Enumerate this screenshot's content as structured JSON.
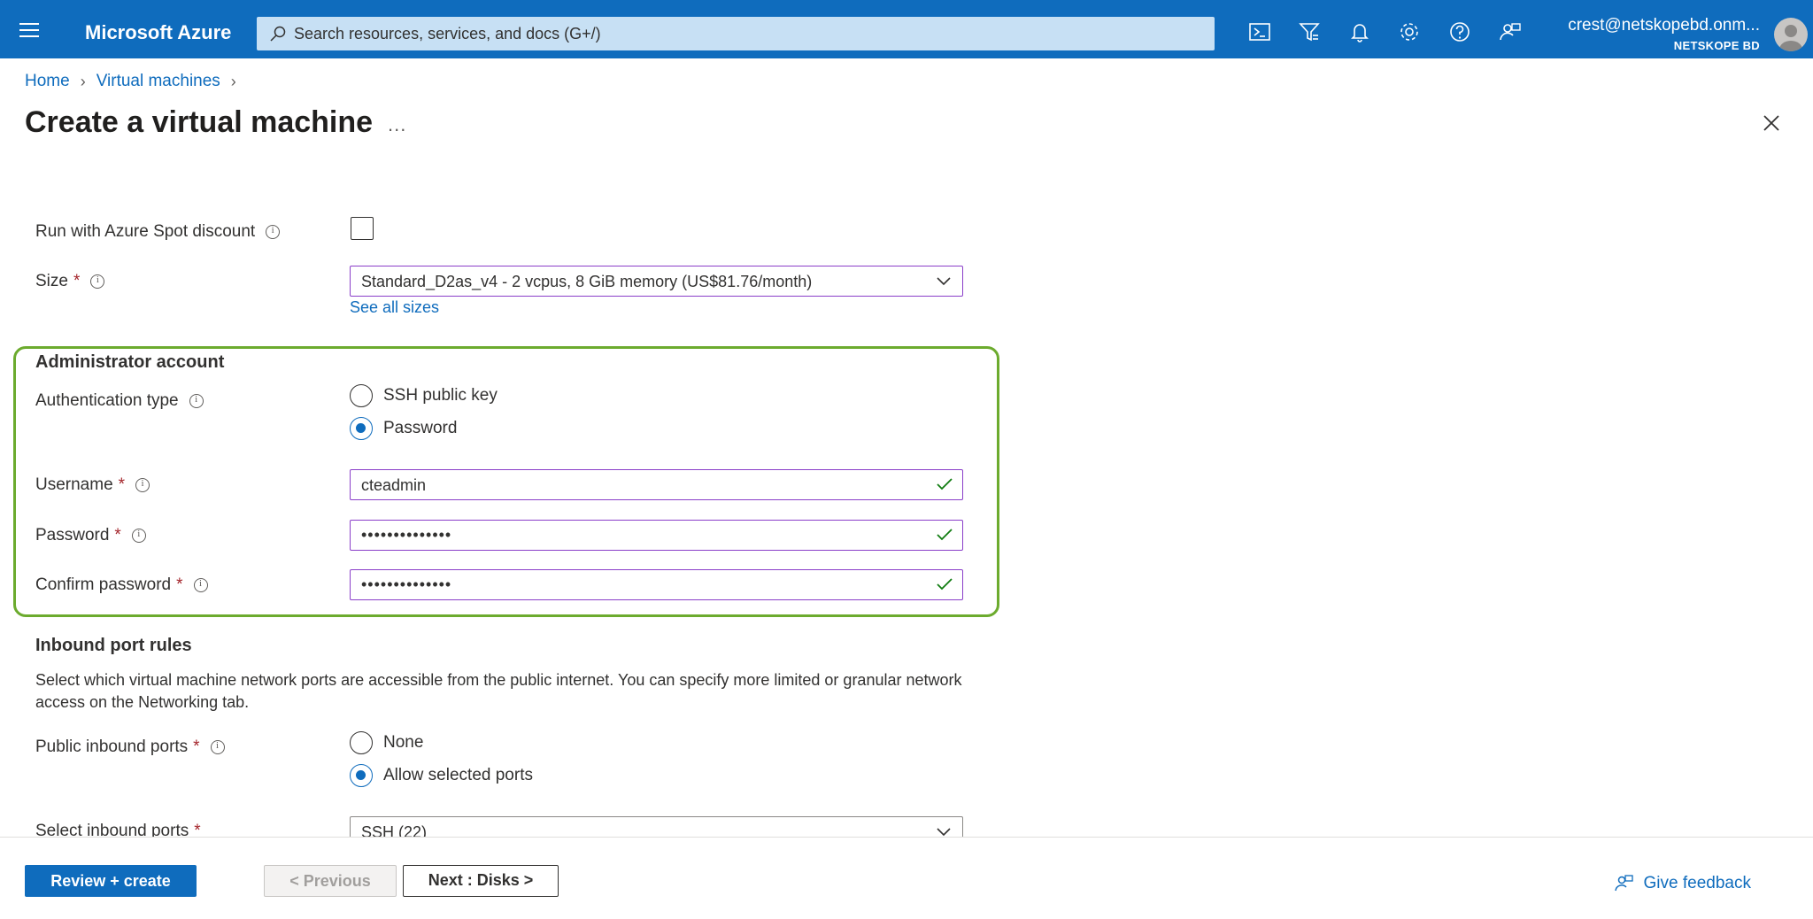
{
  "topbar": {
    "brand": "Microsoft Azure",
    "search_placeholder": "Search resources, services, and docs (G+/)",
    "user_email": "crest@netskopebd.onm...",
    "user_tenant": "NETSKOPE BD"
  },
  "breadcrumb": {
    "home": "Home",
    "virtual_machines": "Virtual machines"
  },
  "page": {
    "title": "Create a virtual machine",
    "ellipsis": "..."
  },
  "form": {
    "spot_label": "Run with Azure Spot discount",
    "size_label": "Size",
    "size_value": "Standard_D2as_v4 - 2 vcpus, 8 GiB memory (US$81.76/month)",
    "see_all_sizes": "See all sizes",
    "admin": {
      "heading": "Administrator account",
      "auth_label": "Authentication type",
      "auth_options": [
        "SSH public key",
        "Password"
      ],
      "auth_selected": "Password",
      "username_label": "Username",
      "username_value": "cteadmin",
      "password_label": "Password",
      "password_value": "••••••••••••••",
      "confirm_label": "Confirm password",
      "confirm_value": "••••••••••••••"
    },
    "inbound": {
      "heading": "Inbound port rules",
      "description": "Select which virtual machine network ports are accessible from the public internet. You can specify more limited or granular network access on the Networking tab.",
      "public_label": "Public inbound ports",
      "public_options": [
        "None",
        "Allow selected ports"
      ],
      "public_selected": "Allow selected ports",
      "select_label": "Select inbound ports",
      "select_value": "SSH (22)"
    },
    "required_marker": "*"
  },
  "footer": {
    "review_create": "Review + create",
    "previous": "< Previous",
    "next": "Next : Disks >",
    "feedback": "Give feedback"
  },
  "colors": {
    "azure_blue": "#0f6cbd",
    "field_border": "#8a3ec9",
    "highlight_box": "#6cab2e",
    "valid_check": "#107c10",
    "required": "#a4262c"
  }
}
